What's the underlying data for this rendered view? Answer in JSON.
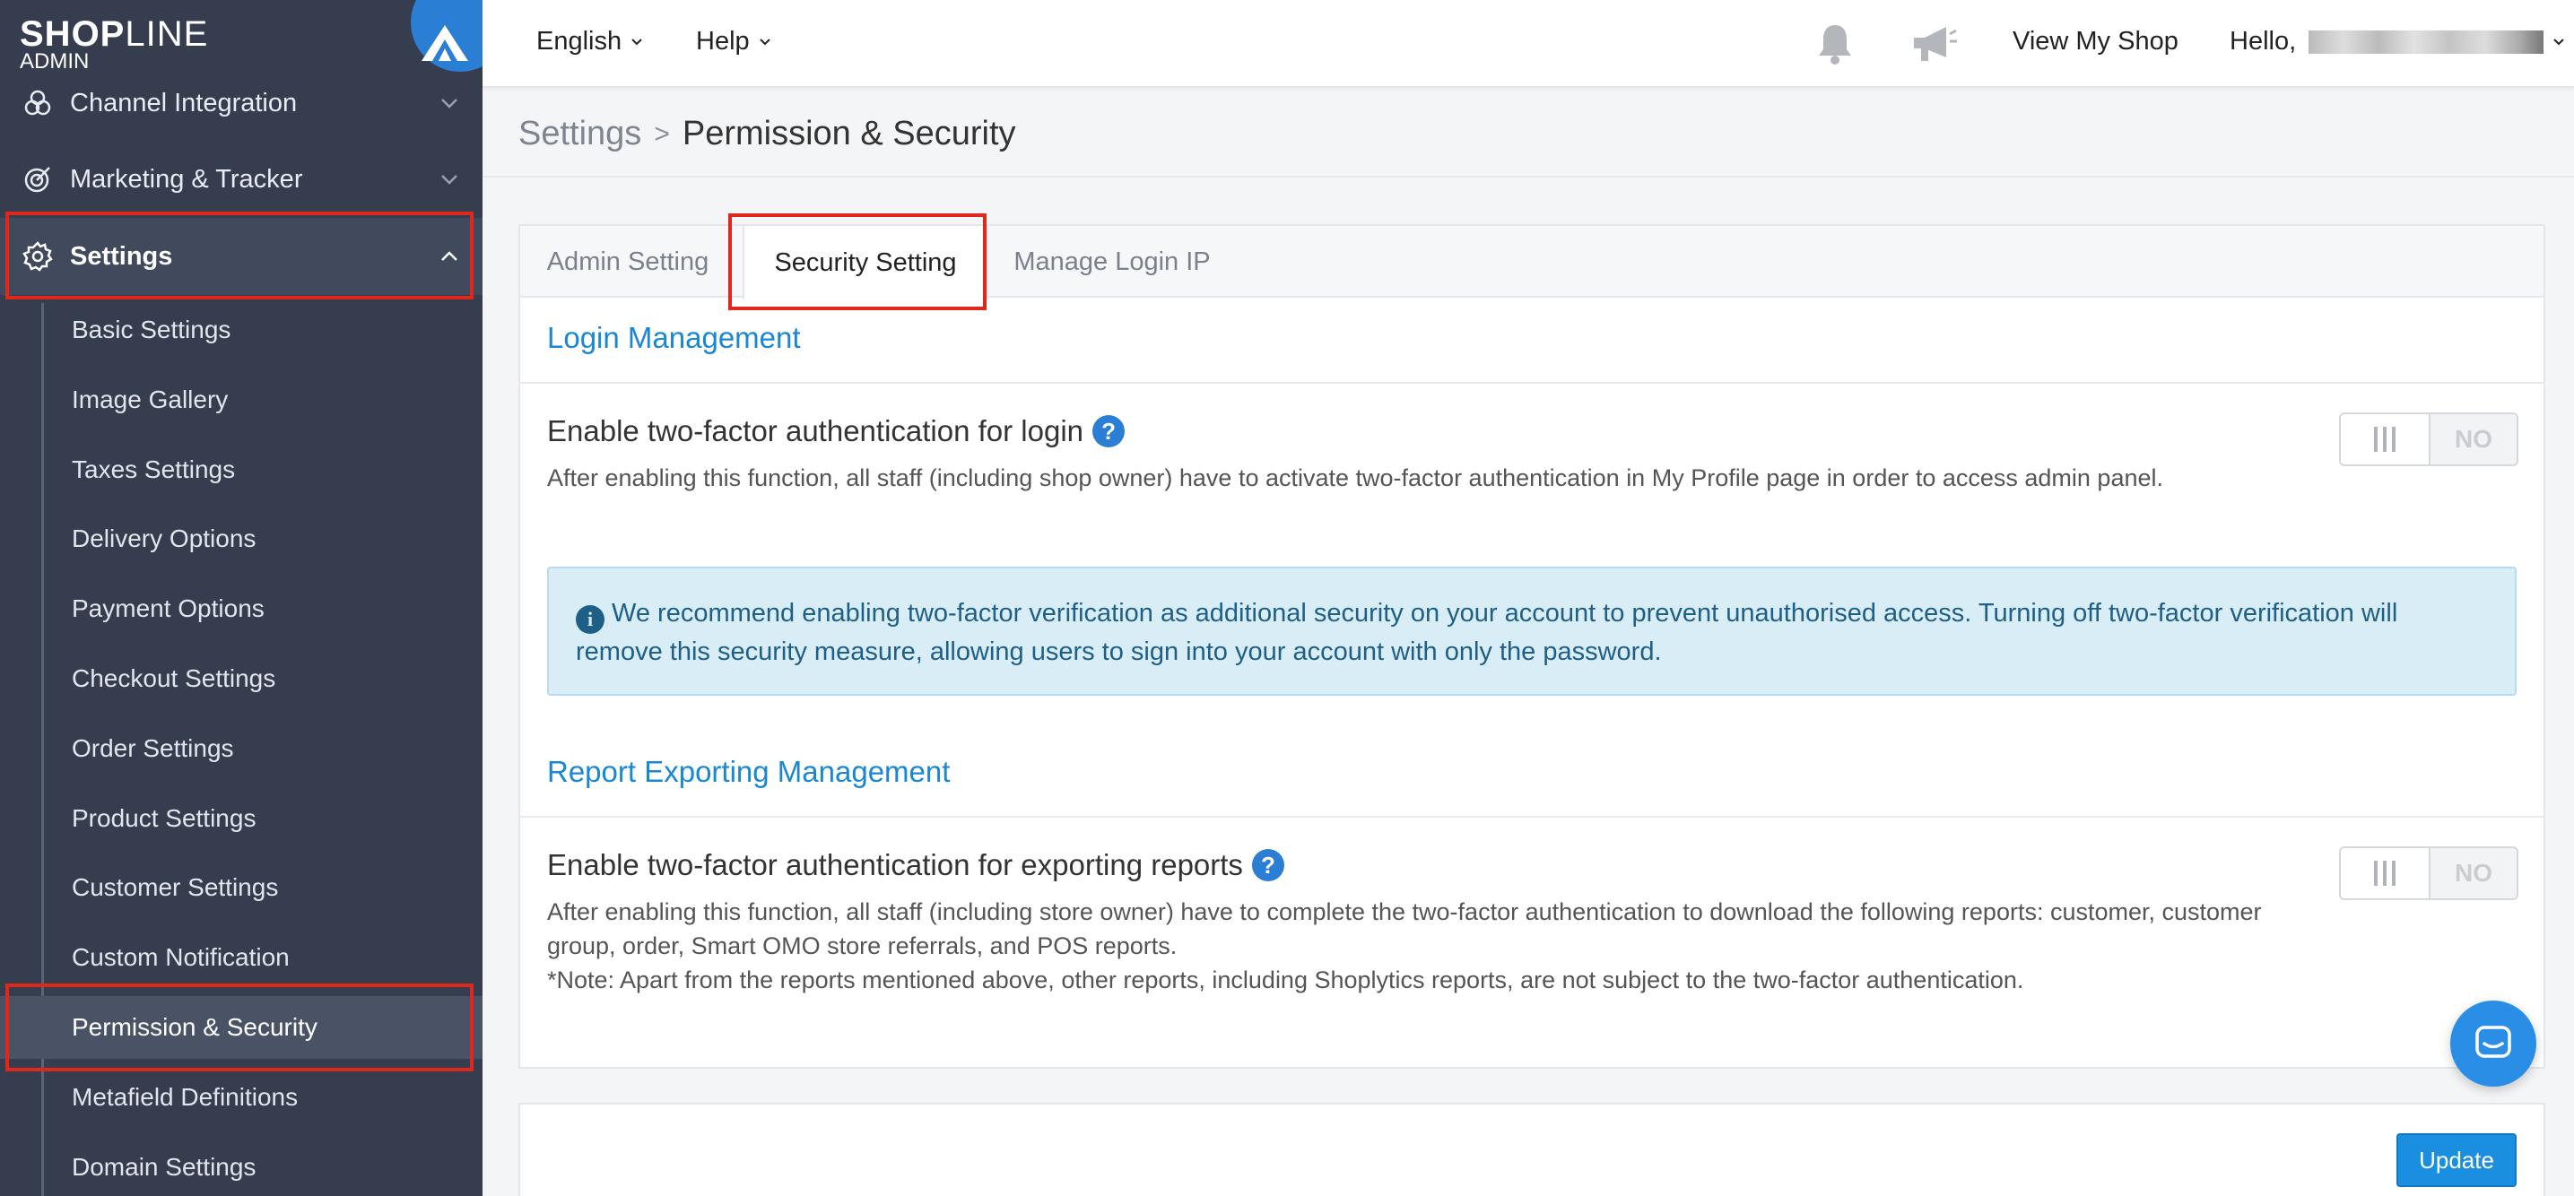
{
  "brand": {
    "logo_bold": "SHOP",
    "logo_thin": "LINE",
    "logo_sub": "ADMIN"
  },
  "sidebar": {
    "items": [
      {
        "label": "Channel Integration",
        "icon": "channel-icon"
      },
      {
        "label": "Marketing & Tracker",
        "icon": "marketing-icon"
      },
      {
        "label": "Settings",
        "icon": "gear-icon"
      }
    ],
    "settings_submenu": [
      {
        "label": "Basic Settings"
      },
      {
        "label": "Image Gallery"
      },
      {
        "label": "Taxes Settings"
      },
      {
        "label": "Delivery Options"
      },
      {
        "label": "Payment Options"
      },
      {
        "label": "Checkout Settings"
      },
      {
        "label": "Order Settings"
      },
      {
        "label": "Product Settings"
      },
      {
        "label": "Customer Settings"
      },
      {
        "label": "Custom Notification"
      },
      {
        "label": "Permission & Security"
      },
      {
        "label": "Metafield Definitions"
      },
      {
        "label": "Domain Settings"
      }
    ]
  },
  "topbar": {
    "language": "English",
    "help": "Help",
    "view_shop": "View My Shop",
    "greeting": "Hello,"
  },
  "breadcrumb": {
    "parent": "Settings",
    "separator": ">",
    "current": "Permission & Security"
  },
  "tabs": [
    {
      "label": "Admin Setting"
    },
    {
      "label": "Security Setting"
    },
    {
      "label": "Manage Login IP"
    }
  ],
  "login_management": {
    "title": "Login Management",
    "setting_title": "Enable two-factor authentication for login",
    "description": "After enabling this function, all staff (including shop owner) have to activate two-factor authentication in My Profile page in order to access admin panel.",
    "toggle_state": "NO",
    "alert": "We recommend enabling two-factor verification as additional security on your account to prevent unauthorised access. Turning off two-factor verification will remove this security measure, allowing users to sign into your account with only the password."
  },
  "report_management": {
    "title": "Report Exporting Management",
    "setting_title": "Enable two-factor authentication for exporting reports",
    "description_1": "After enabling this function, all staff (including store owner) have to complete the two-factor authentication to download the following reports: customer, customer group, order, Smart OMO store referrals, and POS reports.",
    "description_2": "*Note: Apart from the reports mentioned above, other reports, including Shoplytics reports, are not subject to the two-factor authentication.",
    "toggle_state": "NO"
  },
  "actions": {
    "update_label": "Update"
  },
  "colors": {
    "sidebar_bg": "#353d4e",
    "accent": "#1a87d4",
    "highlight": "#e0271b",
    "alert_bg": "#d9edf7"
  }
}
